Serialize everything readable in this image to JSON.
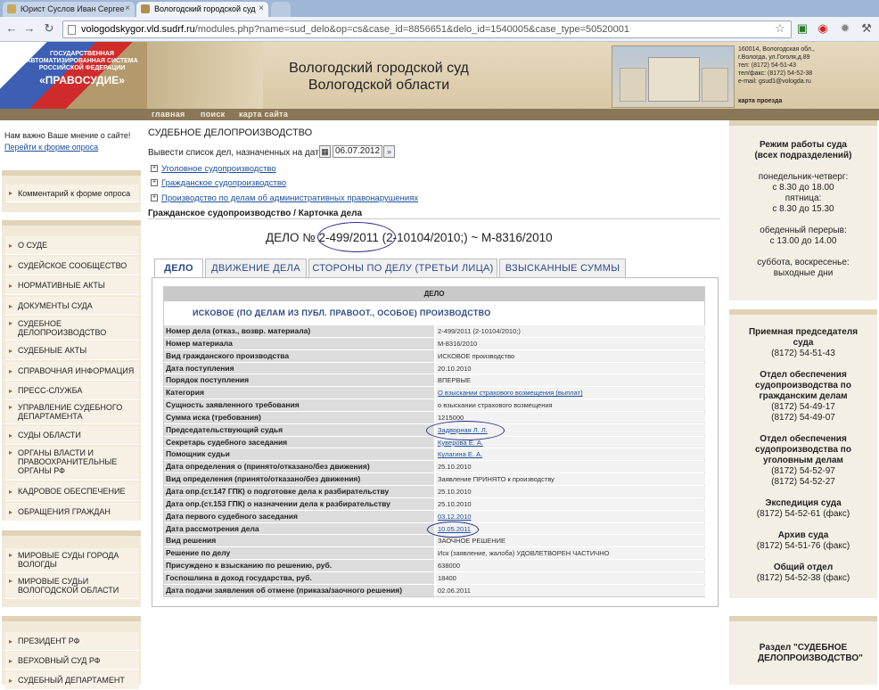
{
  "browser": {
    "tabs": [
      {
        "title": "Юрист Суслов Иван Сергее"
      },
      {
        "title": "Вологодский городской суд"
      }
    ],
    "url_host": "vologodskygor.vld.sudrf.ru",
    "url_path": "/modules.php?name=sud_delo&op=cs&case_id=8856651&delo_id=1540005&case_type=50520001"
  },
  "banner": {
    "logo_line1": "ГОСУДАРСТВЕННАЯ АВТОМАТИЗИРОВАННАЯ СИСТЕМА РОССИЙСКОЙ ФЕДЕРАЦИИ",
    "logo_line2": "«ПРАВОСУДИЕ»",
    "court_name_1": "Вологодский городской суд",
    "court_name_2": "Вологодской области",
    "contacts": [
      "160014, Вологодская обл.,",
      "г.Вологда, ул.Гоголя,д.89",
      "тел: (8172) 54-51-43",
      "тел/факс: (8172) 54-52-38",
      "e-mail: gsud1@vologda.ru"
    ],
    "map_link": "карта проезда",
    "menu": [
      "главная",
      "поиск",
      "карта сайта"
    ]
  },
  "left": {
    "poll_text": "Нам важно Ваше мнение о сайте!",
    "poll_link": "Перейти к форме опроса",
    "comment": "Комментарий к форме опроса",
    "menu": [
      "О СУДЕ",
      "СУДЕЙСКОЕ СООБЩЕСТВО",
      "НОРМАТИВНЫЕ АКТЫ",
      "ДОКУМЕНТЫ СУДА",
      "СУДЕБНОЕ ДЕЛОПРОИЗВОДСТВО",
      "СУДЕБНЫЕ АКТЫ",
      "СПРАВОЧНАЯ ИНФОРМАЦИЯ",
      "ПРЕСС-СЛУЖБА",
      "УПРАВЛЕНИЕ СУДЕБНОГО ДЕПАРТАМЕНТА",
      "СУДЫ ОБЛАСТИ",
      "ОРГАНЫ ВЛАСТИ И ПРАВООХРАНИТЕЛЬНЫЕ ОРГАНЫ РФ",
      "КАДРОВОЕ ОБЕСПЕЧЕНИЕ",
      "ОБРАЩЕНИЯ ГРАЖДАН"
    ],
    "courts": [
      "МИРОВЫЕ СУДЫ ГОРОДА ВОЛОГДЫ",
      "МИРОВЫЕ СУДЬИ ВОЛОГОДСКОЙ ОБЛАСТИ"
    ],
    "links": [
      "ПРЕЗИДЕНТ РФ",
      "ВЕРХОВНЫЙ СУД РФ",
      "СУДЕБНЫЙ ДЕПАРТАМЕНТ"
    ]
  },
  "main": {
    "section_title": "СУДЕБНОЕ ДЕЛОПРОИЗВОДСТВО",
    "date_label": "Вывести список дел, назначенных на дату",
    "date_value": "06.07.2012",
    "categories": [
      "Уголовное судопроизводство",
      "Гражданское судопроизводство",
      "Производство по делам об административных правонарушениях"
    ],
    "breadcrumb": "Гражданское судопроизводство / Карточка дела",
    "case_prefix": "ДЕЛО №",
    "case_number": "2-499/2011",
    "case_rest": "(2-10104/2010;) ~ М-8316/2010",
    "tabs": [
      "ДЕЛО",
      "ДВИЖЕНИЕ ДЕЛА",
      "СТОРОНЫ ПО ДЕЛУ (ТРЕТЬИ ЛИЦА)",
      "ВЗЫСКАННЫЕ СУММЫ"
    ],
    "table_header": "ДЕЛО",
    "table_sub": "ИСКОВОЕ (ПО ДЕЛАМ ИЗ ПУБЛ. ПРАВООТ., ОСОБОЕ) ПРОИЗВОДСТВО",
    "rows": [
      {
        "k": "Номер дела (отказ., возвр. материала)",
        "v": "2-499/2011 (2-10104/2010;)"
      },
      {
        "k": "Номер материала",
        "v": "М-8316/2010"
      },
      {
        "k": "Вид гражданского производства",
        "v": "ИСКОВОЕ производство"
      },
      {
        "k": "Дата поступления",
        "v": "20.10.2010"
      },
      {
        "k": "Порядок поступления",
        "v": "ВПЕРВЫЕ"
      },
      {
        "k": "Категория",
        "v": "О взыскании страхового возмещения (выплат)"
      },
      {
        "k": "Сущность заявленного требования",
        "v": "о взыскании страхового возмещения"
      },
      {
        "k": "Сумма иска (требования)",
        "v": "1215000"
      },
      {
        "k": "Председательствующий судья",
        "v": "Задворная Л. Л."
      },
      {
        "k": "Секретарь судебного заседания",
        "v": "Куверова Е. А."
      },
      {
        "k": "Помощник судьи",
        "v": "Кулагина Е. А."
      },
      {
        "k": "Дата определения о (принято/отказано/без движения)",
        "v": "25.10.2010"
      },
      {
        "k": "Вид определения (принято/отказано/без движения)",
        "v": "Заявление ПРИНЯТО к производству"
      },
      {
        "k": "Дата опр.(ст.147 ГПК) о подготовке дела к разбирательству",
        "v": "25.10.2010"
      },
      {
        "k": "Дата опр.(ст.153 ГПК) о назначении дела к разбирательству",
        "v": "25.10.2010"
      },
      {
        "k": "Дата первого судебного заседания",
        "v": "03.12.2010"
      },
      {
        "k": "Дата рассмотрения дела",
        "v": "10.05.2011"
      },
      {
        "k": "Вид решения",
        "v": "ЗАОЧНОЕ РЕШЕНИЕ"
      },
      {
        "k": "Решение по делу",
        "v": "Иск (заявление, жалоба) УДОВЛЕТВОРЕН ЧАСТИЧНО"
      },
      {
        "k": "Присуждено к взысканию по решению, руб.",
        "v": "638000"
      },
      {
        "k": "Госпошлина в доход государства, руб.",
        "v": "18400"
      },
      {
        "k": "Дата подачи заявления об отмене (приказа/заочного решения)",
        "v": "02.06.2011"
      }
    ]
  },
  "right": {
    "hours_title": "Режим работы суда (всех подразделений)",
    "hours_lines": [
      "понедельник-четверг:",
      "с 8.30 до 18.00",
      "пятница:",
      "с 8.30 до 15.30",
      "",
      "обеденный перерыв:",
      "с 13.00 до 14.00",
      "",
      "суббота, воскресенье:",
      "выходные дни"
    ],
    "contacts": [
      {
        "title": "Приемная председателя суда",
        "phones": [
          "(8172) 54-51-43"
        ]
      },
      {
        "title": "Отдел обеспечения судопроизводства по гражданским делам",
        "phones": [
          "(8172) 54-49-17",
          "(8172) 54-49-07"
        ]
      },
      {
        "title": "Отдел обеспечения судопроизводства по уголовным делам",
        "phones": [
          "(8172) 54-52-97",
          "(8172) 54-52-27"
        ]
      },
      {
        "title": "Экспедиция суда",
        "phones": [
          "(8172) 54-52-61 (факс)"
        ]
      },
      {
        "title": "Архив суда",
        "phones": [
          "(8172) 54-51-76 (факс)"
        ]
      },
      {
        "title": "Общий отдел",
        "phones": [
          "(8172) 54-52-38 (факс)"
        ]
      }
    ],
    "section_title": "Раздел \"СУДЕБНОЕ ДЕЛОПРОИЗВОДСТВО\""
  }
}
